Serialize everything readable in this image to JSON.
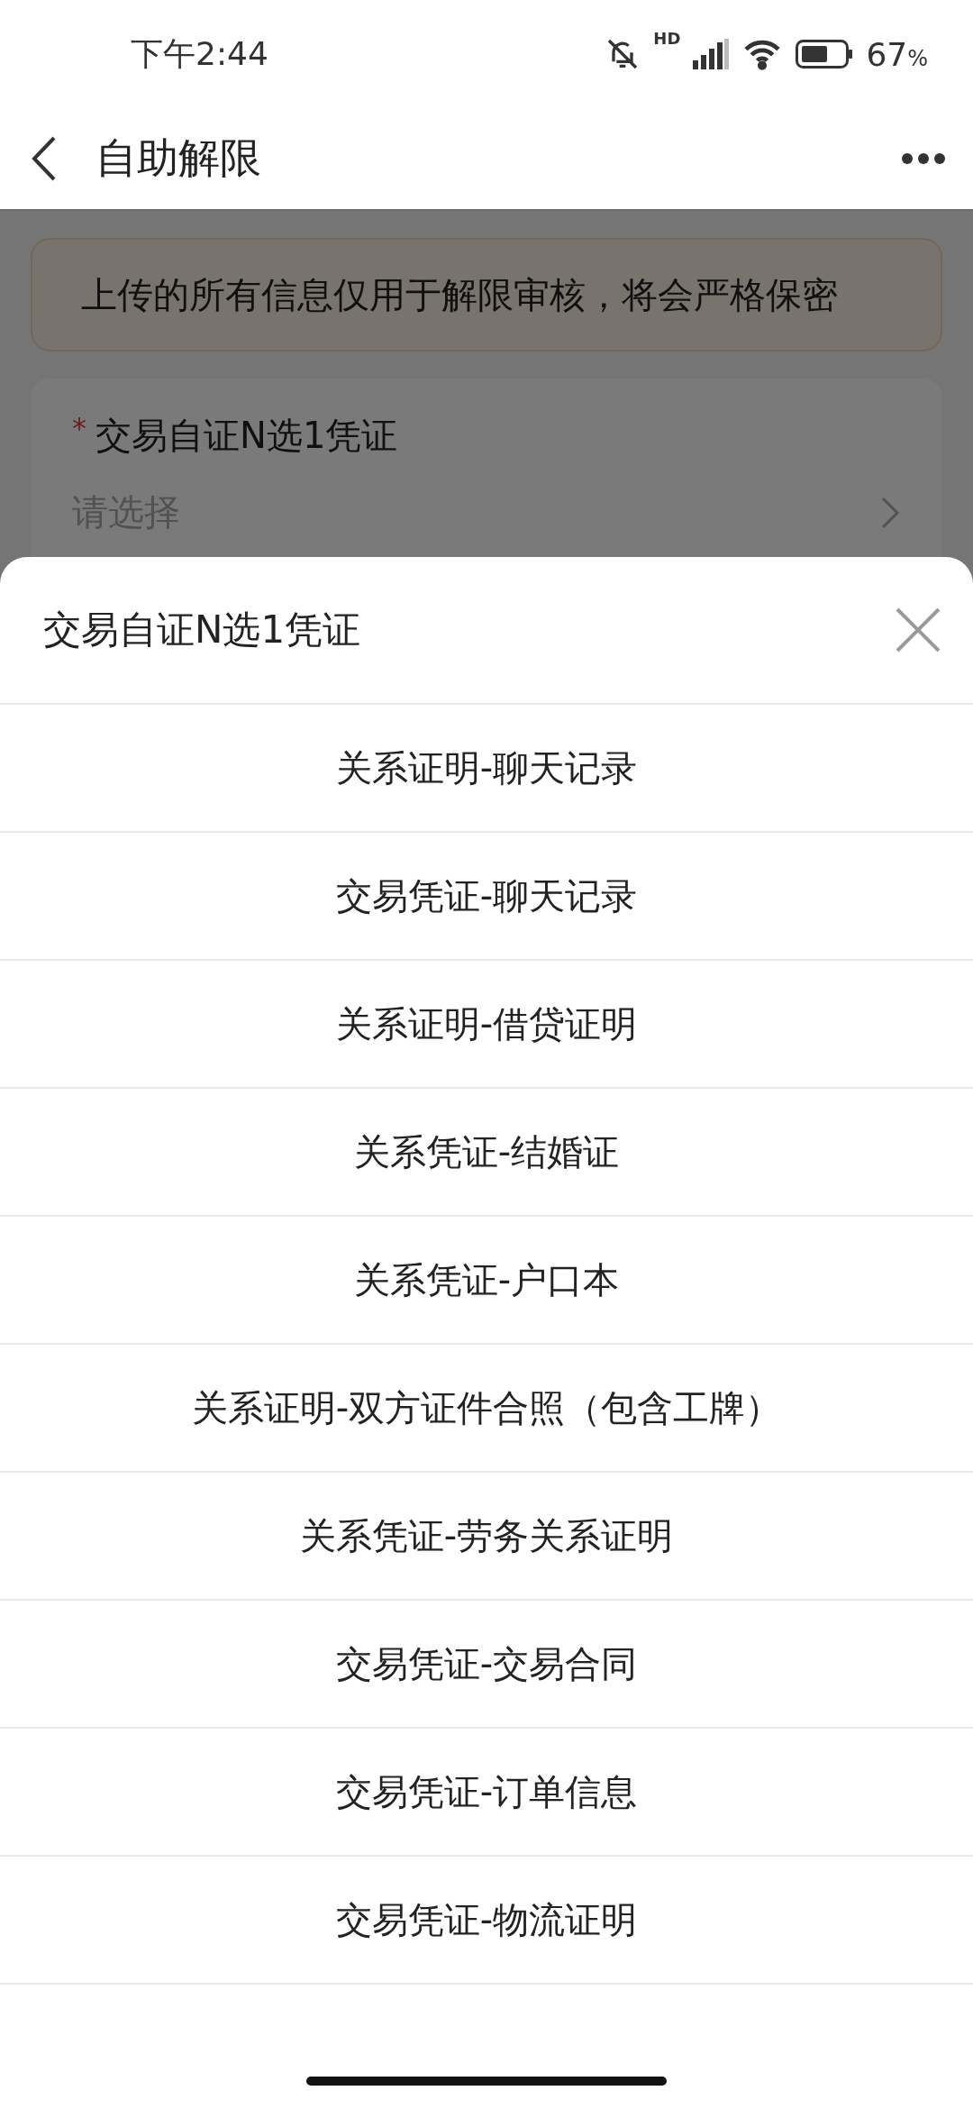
{
  "status_bar": {
    "time": "下午2:44",
    "network": "HD",
    "battery": "67",
    "battery_unit": "%"
  },
  "nav": {
    "title": "自助解限"
  },
  "notice": {
    "text": "上传的所有信息仅用于解限审核，将会严格保密"
  },
  "form": {
    "required_mark": "*",
    "label": "交易自证N选1凭证",
    "placeholder": "请选择"
  },
  "sheet": {
    "title": "交易自证N选1凭证",
    "options": [
      {
        "label": "关系证明-聊天记录"
      },
      {
        "label": "交易凭证-聊天记录"
      },
      {
        "label": "关系证明-借贷证明"
      },
      {
        "label": "关系凭证-结婚证"
      },
      {
        "label": "关系凭证-户口本"
      },
      {
        "label": "关系证明-双方证件合照（包含工牌）"
      },
      {
        "label": "关系凭证-劳务关系证明"
      },
      {
        "label": "交易凭证-交易合同"
      },
      {
        "label": "交易凭证-订单信息"
      },
      {
        "label": "交易凭证-物流证明"
      }
    ]
  }
}
